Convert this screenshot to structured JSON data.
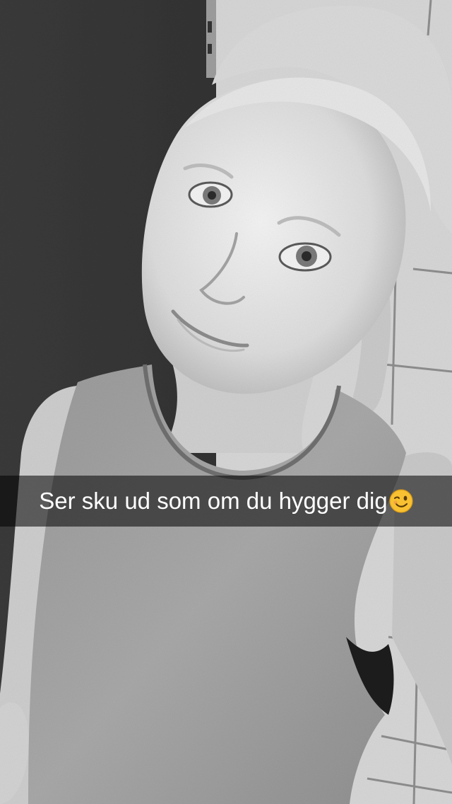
{
  "snap": {
    "caption": "Ser sku ud som om du hygger dig",
    "caption_emoji": "winking-face-icon",
    "photo": "black-and-white selfie photo"
  },
  "colors": {
    "caption_bar": "#000000",
    "caption_text": "#ffffff",
    "emoji_face": "#f7c132"
  }
}
